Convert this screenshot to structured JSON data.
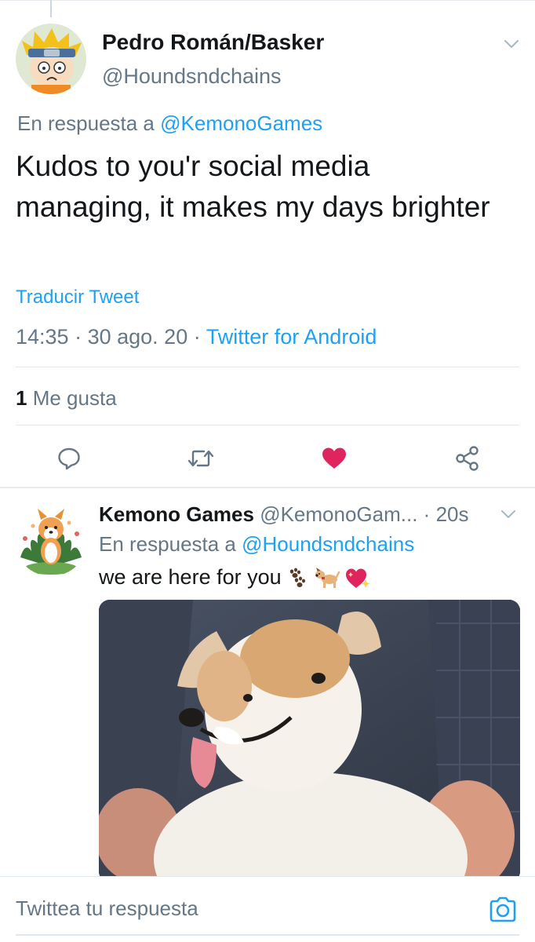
{
  "main_tweet": {
    "author_name": "Pedro Román/Basker",
    "author_handle": "@Houndsndchains",
    "reply_prefix": "En respuesta a",
    "reply_mention": "@KemonoGames",
    "text": "Kudos to you'r social media managing, it makes my days brighter",
    "translate_label": "Traducir Tweet",
    "time": "14:35",
    "date": "30 ago. 20",
    "source": "Twitter for Android",
    "likes_count": "1",
    "likes_label": "Me gusta",
    "liked": true
  },
  "reply_tweet": {
    "author_name": "Kemono Games",
    "author_handle": "@KemonoGam...",
    "time_ago": "20s",
    "reply_prefix": "En respuesta a",
    "reply_mention": "@Houndsndchains",
    "text": "we are here for you",
    "emojis": [
      "paw-prints-emoji",
      "dog-emoji",
      "sparkling-heart-emoji"
    ]
  },
  "composer": {
    "placeholder": "Twittea tu respuesta"
  },
  "colors": {
    "accent": "#1da1f2",
    "secondary_text": "#657786",
    "like": "#e0245e",
    "divider": "#e1e8ed"
  },
  "icons": {
    "reply": "speech-bubble-icon",
    "retweet": "retweet-arrows-icon",
    "like": "heart-icon",
    "share": "share-nodes-icon",
    "caret": "chevron-down-icon",
    "camera": "camera-icon"
  }
}
